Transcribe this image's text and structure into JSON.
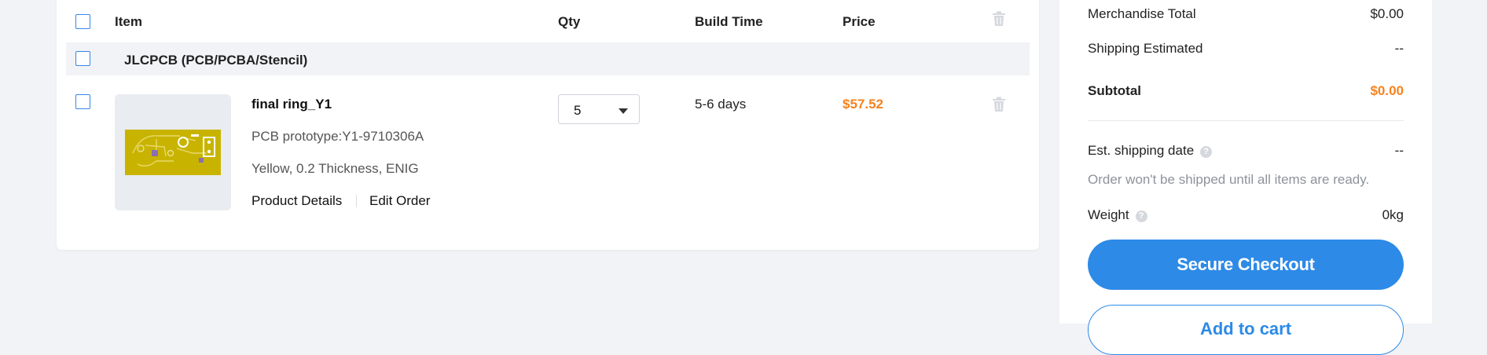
{
  "cart": {
    "headers": {
      "item": "Item",
      "qty": "Qty",
      "build_time": "Build Time",
      "price": "Price"
    },
    "group": {
      "label": "JLCPCB (PCB/PCBA/Stencil)"
    },
    "items": [
      {
        "name": "final ring_Y1",
        "line1": "PCB prototype:Y1-9710306A",
        "line2": "Yellow, 0.2 Thickness, ENIG",
        "details_link": "Product Details",
        "edit_link": "Edit Order",
        "qty": "5",
        "build_time": "5-6 days",
        "price": "$57.52"
      }
    ]
  },
  "summary": {
    "merchandise_total_label": "Merchandise Total",
    "merchandise_total_value": "$0.00",
    "shipping_label": "Shipping Estimated",
    "shipping_value": "--",
    "subtotal_label": "Subtotal",
    "subtotal_value": "$0.00",
    "est_shipping_label": "Est. shipping date",
    "est_shipping_value": "--",
    "note": "Order won't be shipped until all items are ready.",
    "weight_label": "Weight",
    "weight_value": "0kg",
    "checkout_button": "Secure Checkout",
    "add_button": "Add to cart"
  },
  "icons": {
    "trash": "trash-icon",
    "help": "question-circle-icon",
    "caret": "chevron-down-icon"
  },
  "colors": {
    "accent": "#2d8ae7",
    "price": "#f6821f",
    "pcb": "#c8b400"
  }
}
